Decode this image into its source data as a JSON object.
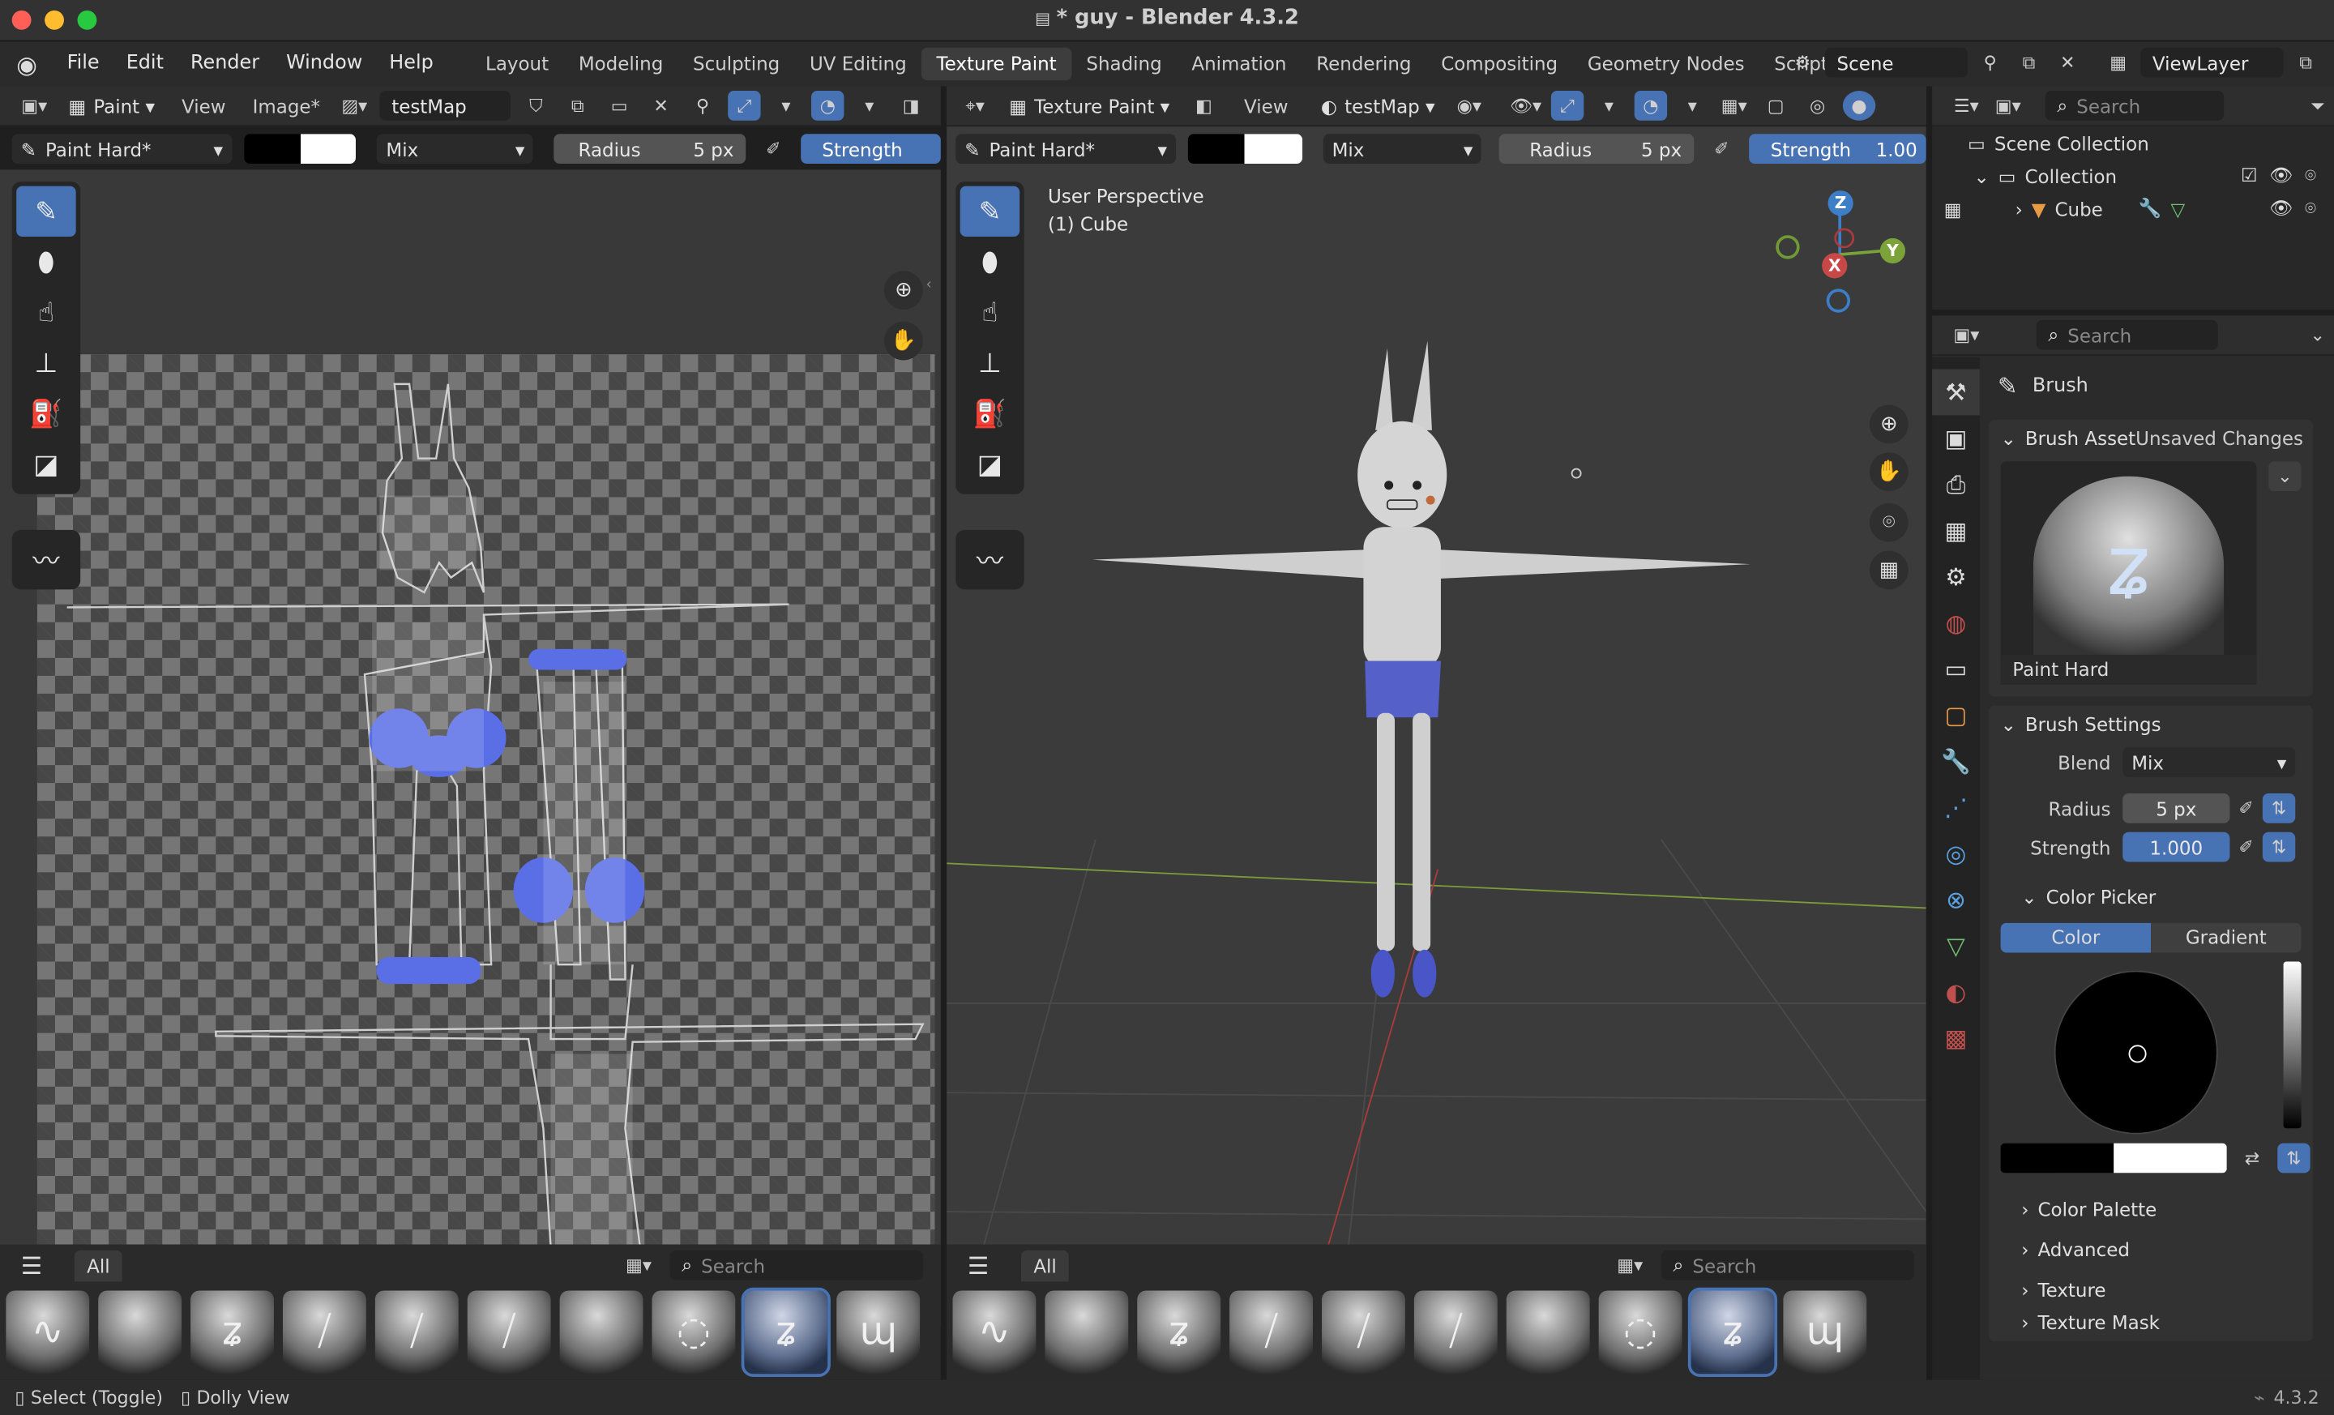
{
  "window": {
    "title": "* guy - Blender 4.3.2",
    "colors": {
      "close": "#ff5f57",
      "min": "#febc2e",
      "max": "#28c840"
    }
  },
  "menu": {
    "items": [
      "File",
      "Edit",
      "Render",
      "Window",
      "Help"
    ]
  },
  "workspaces": {
    "tabs": [
      "Layout",
      "Modeling",
      "Sculpting",
      "UV Editing",
      "Texture Paint",
      "Shading",
      "Animation",
      "Rendering",
      "Compositing",
      "Geometry Nodes",
      "Scripting"
    ],
    "active": "Texture Paint",
    "add": "+"
  },
  "scene": {
    "name": "Scene",
    "view_layer": "ViewLayer"
  },
  "image_editor": {
    "header": {
      "mode": "Paint",
      "view": "View",
      "image_menu": "Image*",
      "image_name": "testMap"
    },
    "toolbar": {
      "brush": "Paint Hard*",
      "blend": "Mix",
      "radius_label": "Radius",
      "radius_value": "5 px",
      "strength_label": "Strength"
    },
    "asset": {
      "menu": "☰",
      "tab": "All",
      "search_placeholder": "Search"
    }
  },
  "viewport": {
    "header": {
      "mode": "Texture Paint",
      "view": "View",
      "image": "testMap"
    },
    "toolbar": {
      "brush": "Paint Hard*",
      "blend": "Mix",
      "radius_label": "Radius",
      "radius_value": "5 px",
      "strength_label": "Strength",
      "strength_value": "1.00"
    },
    "overlay": {
      "perspective": "User Perspective",
      "object": "(1) Cube"
    },
    "gizmo": {
      "x": "X",
      "y": "Y",
      "z": "Z"
    },
    "asset": {
      "tab": "All",
      "search_placeholder": "Search"
    }
  },
  "outliner": {
    "search_placeholder": "Search",
    "scene_collection": "Scene Collection",
    "collection": "Collection",
    "object": "Cube"
  },
  "properties": {
    "search_placeholder": "Search",
    "title": "Brush",
    "asset_section": "Brush Asset",
    "unsaved": "Unsaved Changes",
    "preview_name": "Paint Hard",
    "settings_section": "Brush Settings",
    "blend_label": "Blend",
    "blend_value": "Mix",
    "radius_label": "Radius",
    "radius_value": "5 px",
    "strength_label": "Strength",
    "strength_value": "1.000",
    "color_picker": "Color Picker",
    "color_tab": "Color",
    "gradient_tab": "Gradient",
    "sub_sections": [
      "Color Palette",
      "Advanced",
      "Texture",
      "Texture Mask"
    ]
  },
  "status": {
    "select": "Select (Toggle)",
    "dolly": "Dolly View",
    "version": "4.3.2"
  }
}
